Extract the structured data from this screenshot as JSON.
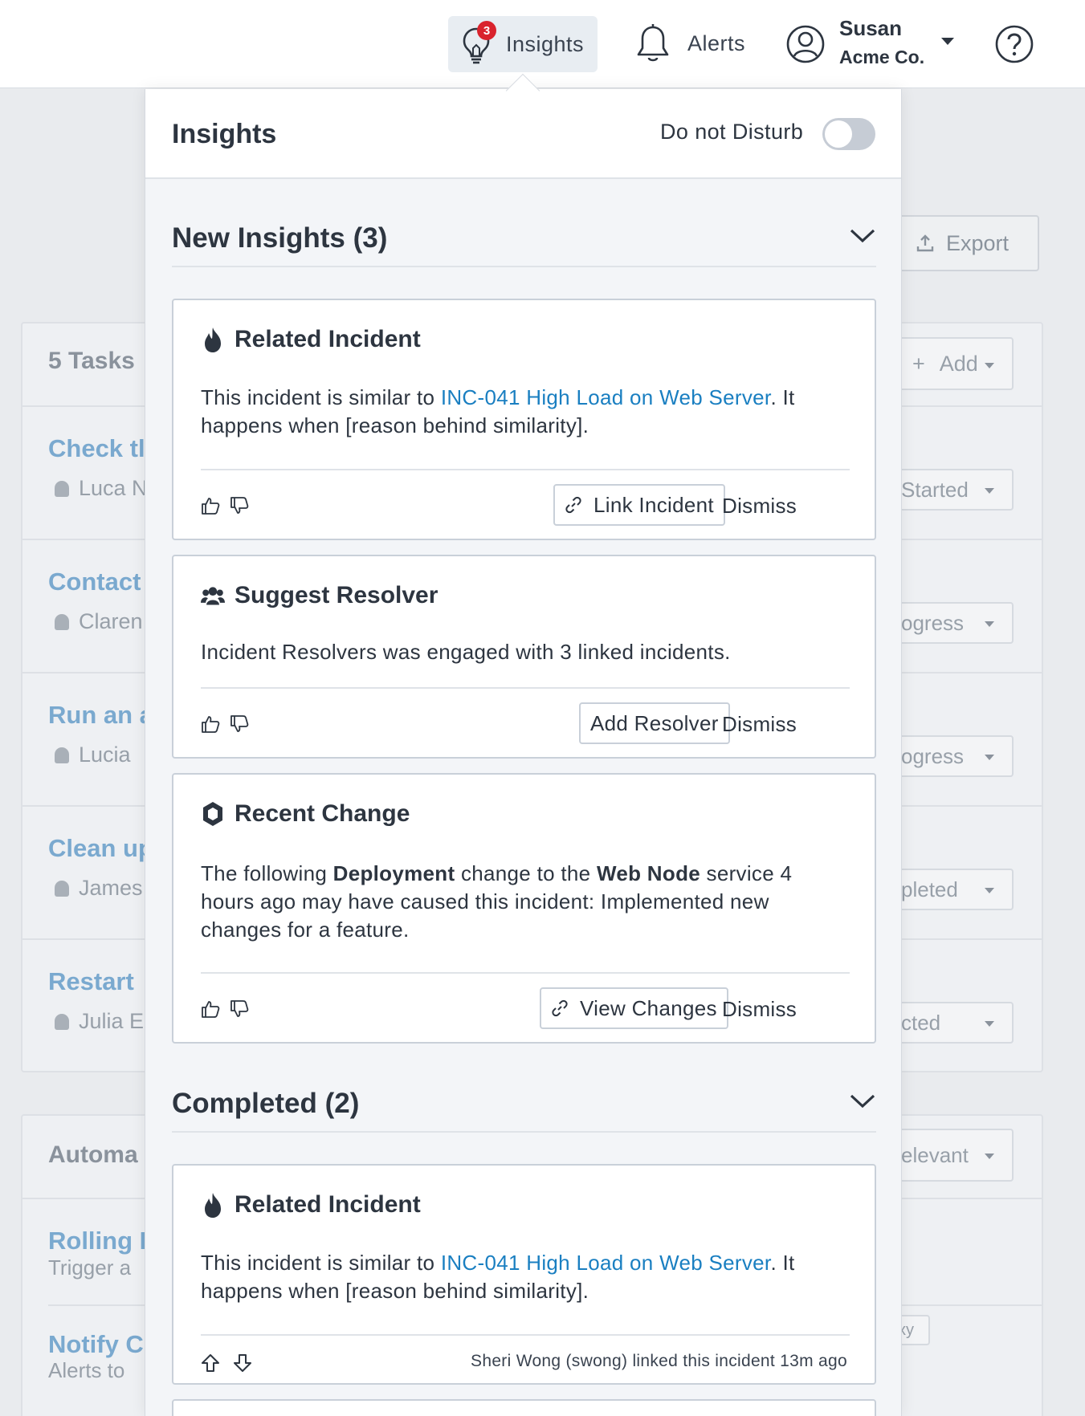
{
  "topbar": {
    "insights_label": "Insights",
    "insights_badge": "3",
    "alerts_label": "Alerts",
    "user_name": "Susan",
    "user_org": "Acme Co."
  },
  "background": {
    "export_label": "Export",
    "tasks_header": "5 Tasks",
    "add_label": "Add",
    "tasks": [
      {
        "title": "Check tl",
        "assignee": "Luca N",
        "status": "Started"
      },
      {
        "title": "Contact",
        "assignee": "Claren",
        "status": "ogress"
      },
      {
        "title": "Run an a",
        "assignee": "Lucia",
        "status": "ogress"
      },
      {
        "title": "Clean up",
        "assignee": "James",
        "status": "pleted"
      },
      {
        "title": "Restart",
        "assignee": "Julia E",
        "status": "cted"
      }
    ],
    "automation_header": "Automa",
    "automation_status": "elevant",
    "automations": [
      {
        "title": "Rolling F",
        "desc": "Trigger a",
        "tag": "xy"
      },
      {
        "title": "Notify C",
        "desc": "Alerts to"
      }
    ]
  },
  "panel": {
    "title": "Insights",
    "dnd_label": "Do not Disturb",
    "dnd_on": false,
    "new_section": "New Insights (3)",
    "completed_section": "Completed (2)",
    "cards": [
      {
        "title": "Related Incident",
        "icon": "flame-icon",
        "body_pre": "This incident is similar to ",
        "link": "INC-041 High Load on Web Server",
        "body_post": ". It happens when [reason behind similarity].",
        "action": "Link Incident",
        "dismiss": "Dismiss"
      },
      {
        "title": "Suggest Resolver",
        "icon": "users-icon",
        "body": "Incident Resolvers was engaged with 3 linked incidents.",
        "action": "Add Resolver",
        "dismiss": "Dismiss"
      },
      {
        "title": "Recent Change",
        "icon": "hexagon-icon",
        "body_1": "The following ",
        "bold_1": "Deployment",
        "body_2": " change to the ",
        "bold_2": "Web Node",
        "body_3": " service 4 hours ago may have caused this incident: Implemented new changes for a feature.",
        "action": "View Changes",
        "dismiss": "Dismiss"
      }
    ],
    "completed_cards": [
      {
        "title": "Related Incident",
        "icon": "flame-icon",
        "body_pre": "This incident is similar to ",
        "link": "INC-041 High Load on Web Server",
        "body_post": ". It happens when [reason behind similarity].",
        "note": "Sheri Wong (swong) linked this incident 13m ago"
      }
    ]
  },
  "colors": {
    "link": "#1a7fc1",
    "badge": "#d9232d",
    "text": "#2d3540"
  }
}
